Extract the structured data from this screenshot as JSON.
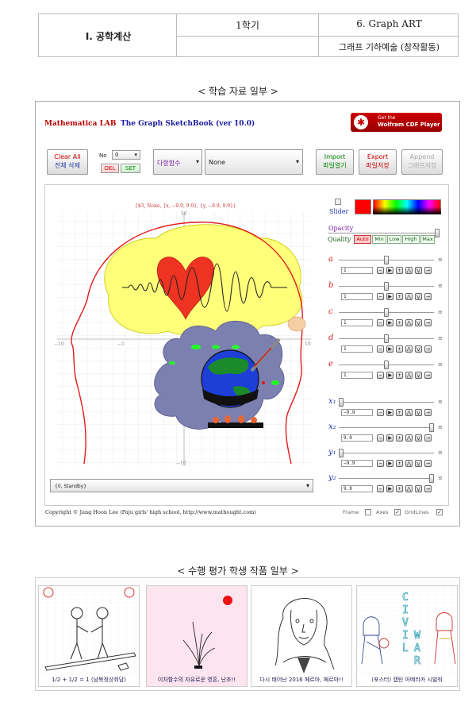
{
  "header": {
    "unit": "Ⅰ. 공학계산",
    "semester": "1학기",
    "chapter": "6. Graph ART",
    "subtitle": "그래프 기하예술 (창작활동)"
  },
  "section1_title": "< 학습 자료 일부 >",
  "app": {
    "brand": "Mathematica LAB",
    "title": "The Graph SketchBook (ver 10.0)",
    "cdf_line1": "Get the",
    "cdf_line2": "Wolfram CDF Player",
    "clear_l1": "Clear All",
    "clear_l2": "전체 삭제",
    "no_label": "No",
    "no_value": "0",
    "del": "DEL",
    "set": "SET",
    "func_type": "다항함수",
    "func_select": "None",
    "import_l1": "Import",
    "import_l2": "파일열기",
    "export_l1": "Export",
    "export_l2": "파일저장",
    "append_l1": "Append",
    "append_l2": "그래프저장",
    "plot_label": "{$3, None, {x, −9.9, 9.9}, {y, −9.9, 9.9}}",
    "status": "{0, Standby}",
    "slider_label": "Slider",
    "opacity_label": "Opacity",
    "quality_label": "Quality",
    "quality_opts": [
      "Auto",
      "Min",
      "Low",
      "High",
      "Max"
    ],
    "params": [
      {
        "name": "a",
        "value": "1"
      },
      {
        "name": "b",
        "value": "1"
      },
      {
        "name": "c",
        "value": "1"
      },
      {
        "name": "d",
        "value": "1"
      },
      {
        "name": "e",
        "value": "1"
      }
    ],
    "ranges": [
      {
        "name": "x₁",
        "value": "−9.9"
      },
      {
        "name": "x₂",
        "value": "9.9"
      },
      {
        "name": "y₁",
        "value": "−9.9"
      },
      {
        "name": "y₂",
        "value": "9.9"
      }
    ],
    "ticks": {
      "t10": "10",
      "tn10": "−10",
      "t5": "5",
      "tn5": "−5"
    },
    "copyright": "Copyright © Jang Hoon Lee (Paju girls' high school, http://www.mathought.com)",
    "frame": "Frame",
    "axes": "Axes",
    "gridlines": "GridLines",
    "accent_red": "#ff0000",
    "brand_color": "#c00000",
    "title_color": "#1a1aa0"
  },
  "section2_title": "< 수행 평가 학생 작품 일부 >",
  "works": [
    {
      "caption": "1/2 + 1/2 = 1 (남북정상회담)"
    },
    {
      "caption": "이차함수의 자유로운 영혼, 난초!!"
    },
    {
      "caption": "다시 태어난 2016 페르마, 페르마!!"
    },
    {
      "caption": "(포스터) 캡틴 아메리카 시빌워"
    }
  ],
  "poster_letters_1": [
    "C",
    "I",
    "V",
    "I",
    "L"
  ],
  "poster_letters_2": [
    "W",
    "A",
    "R"
  ]
}
